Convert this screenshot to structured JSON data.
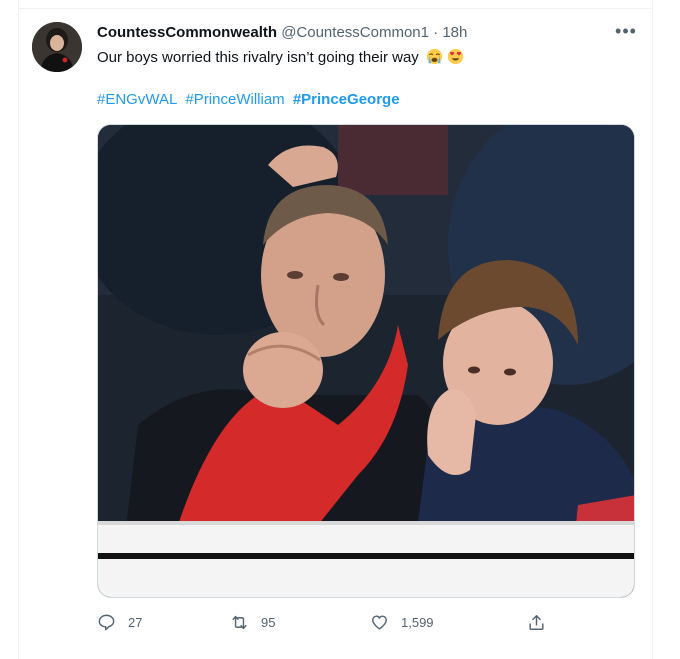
{
  "tweet": {
    "author_name": "CountessCommonwealth",
    "author_handle": "@CountessCommon1",
    "separator": "·",
    "time": "18h",
    "more_label": "•••",
    "text": "Our boys worried this rivalry isn’t going their way",
    "emojis": [
      "crying-face",
      "heart-eyes-face"
    ],
    "hashtags": [
      {
        "text": "#ENGvWAL",
        "bold": false
      },
      {
        "text": "#PrinceWilliam",
        "bold": false
      },
      {
        "text": "#PrinceGeorge",
        "bold": true
      }
    ]
  },
  "actions": {
    "replies": "27",
    "retweets": "95",
    "likes": "1,599"
  },
  "icons": {
    "reply": "reply-icon",
    "retweet": "retweet-icon",
    "like": "heart-icon",
    "share": "share-icon",
    "more": "more-icon"
  },
  "colors": {
    "link": "#1d9bf0",
    "secondary_text": "#536471",
    "primary_text": "#0f1419",
    "border": "#cfd9de"
  }
}
